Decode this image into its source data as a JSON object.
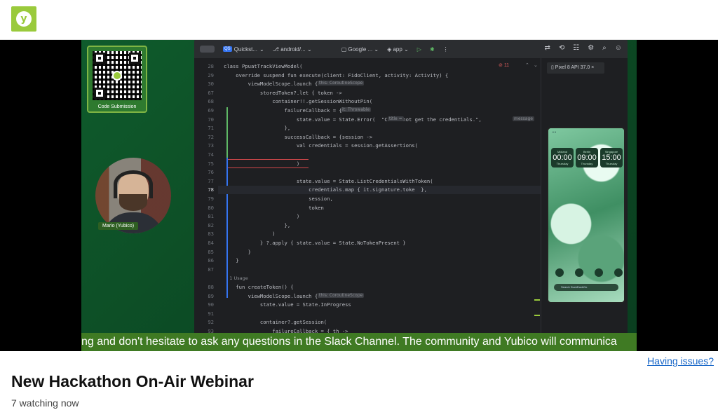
{
  "stream": {
    "title": "New Hackathon On-Air Webinar",
    "watching": "7 watching now",
    "issues_link": "Having issues?"
  },
  "overlay": {
    "qr_label": "Code Submission",
    "presenter_name": "Mario (Yubico)",
    "caption": "ng and don't hesitate to ask any questions in the Slack Channel. The community and Yubico will communica"
  },
  "ide": {
    "project": "Quickst...",
    "branch": "android/...",
    "device_config": "Google ...",
    "run_config": "app",
    "device_tab": "Pixel 8 API 37.0",
    "inspection": "11",
    "lines": [
      {
        "n": "28",
        "text": "class PpuatTrackViewModel("
      },
      {
        "n": "29",
        "text": "    override suspend fun execute(client: FidoClient, activity: Activity) {"
      },
      {
        "n": "30",
        "text": "        viewModelScope.launch {"
      },
      {
        "n": "67",
        "text": "            storedToken?.let { token ->"
      },
      {
        "n": "68",
        "text": "                container!!.getSessionWithoutPin("
      },
      {
        "n": "69",
        "text": "                    failureCallback = {"
      },
      {
        "n": "70",
        "text": "                        state.value = State.Error(  \"Could not get the credentials.\","
      },
      {
        "n": "71",
        "text": "                    },"
      },
      {
        "n": "72",
        "text": "                    successCallback = {session ->"
      },
      {
        "n": "73",
        "text": "                        val credentials = session.getAssertions("
      },
      {
        "n": "74",
        "text": ""
      },
      {
        "n": "75",
        "text": "                        )"
      },
      {
        "n": "76",
        "text": ""
      },
      {
        "n": "77",
        "text": "                        state.value = State.ListCredentialsWithToken("
      },
      {
        "n": "78",
        "text": "                            credentials.map { it.signature.toke  },"
      },
      {
        "n": "79",
        "text": "                            session,"
      },
      {
        "n": "80",
        "text": "                            token"
      },
      {
        "n": "81",
        "text": "                        )"
      },
      {
        "n": "82",
        "text": "                    },"
      },
      {
        "n": "83",
        "text": "                )"
      },
      {
        "n": "84",
        "text": "            } ?.apply { state.value = State.NoTokenPresent }"
      },
      {
        "n": "85",
        "text": "        }"
      },
      {
        "n": "86",
        "text": "    }"
      },
      {
        "n": "87",
        "text": ""
      },
      {
        "n": "",
        "text": "    1 Usage"
      },
      {
        "n": "88",
        "text": "    fun createToken() {"
      },
      {
        "n": "89",
        "text": "        viewModelScope.launch {"
      },
      {
        "n": "90",
        "text": "            state.value = State.InProgress"
      },
      {
        "n": "91",
        "text": ""
      },
      {
        "n": "92",
        "text": "            container?.getSession("
      },
      {
        "n": "93",
        "text": "                failureCallback = { th ->"
      }
    ],
    "hints": {
      "scope": "this: CoroutineScope",
      "throwable": "it: Throwable",
      "title": "title =",
      "message": "message",
      "scope2": "this: CoroutineScope"
    }
  },
  "phone": {
    "clocks": [
      {
        "city": "Midland",
        "time": "00:00",
        "label": "Thursday"
      },
      {
        "city": "Berlin",
        "time": "09:00",
        "label": "Thursday"
      },
      {
        "city": "Singapore",
        "time": "15:00",
        "label": "Thursday"
      }
    ],
    "search_placeholder": "Search DuckDuckGo"
  },
  "colors": {
    "brand": "#9aca3c",
    "caption_bg": "#3f7a23",
    "link": "#1766c8"
  }
}
